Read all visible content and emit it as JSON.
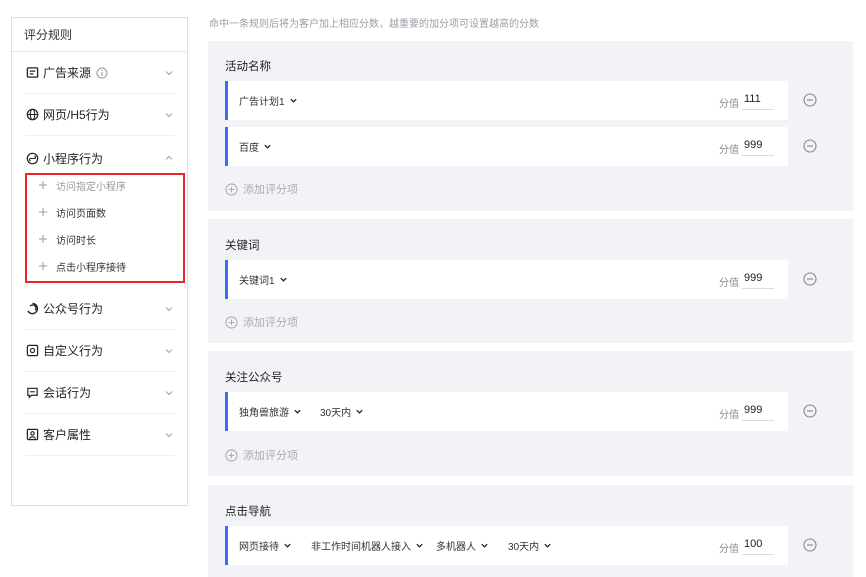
{
  "sidebar": {
    "title": "评分规则",
    "groups": [
      {
        "label": "广告来源",
        "icon": "ad-icon",
        "info": true
      },
      {
        "label": "网页/H5行为",
        "icon": "globe-icon"
      },
      {
        "label": "小程序行为",
        "icon": "miniprogram-icon",
        "expanded": true
      },
      {
        "label": "公众号行为",
        "icon": "official-account-icon"
      },
      {
        "label": "自定义行为",
        "icon": "custom-icon"
      },
      {
        "label": "会话行为",
        "icon": "chat-icon"
      },
      {
        "label": "客户属性",
        "icon": "customer-icon"
      }
    ],
    "sub_items": [
      "访问指定小程序",
      "访问页面数",
      "访问时长",
      "点击小程序接待"
    ]
  },
  "hint": "命中一条规则后将为客户加上相应分数，越重要的加分项可设置越高的分数",
  "score_label": "分值",
  "add_label": "添加评分项",
  "sections": [
    {
      "title": "活动名称",
      "rules": [
        {
          "selects": [
            "广告计划1"
          ],
          "score": "111"
        },
        {
          "selects": [
            "百度"
          ],
          "score": "999"
        }
      ]
    },
    {
      "title": "关键词",
      "rules": [
        {
          "selects": [
            "关键词1"
          ],
          "score": "999"
        }
      ]
    },
    {
      "title": "关注公众号",
      "rules": [
        {
          "selects": [
            "独角兽旅游",
            "30天内"
          ],
          "score": "999"
        }
      ]
    },
    {
      "title": "点击导航",
      "rules": [
        {
          "selects": [
            "网页接待",
            "非工作时间机器人接入",
            "多机器人",
            "30天内"
          ],
          "score": "100"
        }
      ]
    }
  ],
  "colors": {
    "accent": "#3b6df2",
    "highlight_border": "#e8262b",
    "card_bg": "#f2f3f7"
  }
}
